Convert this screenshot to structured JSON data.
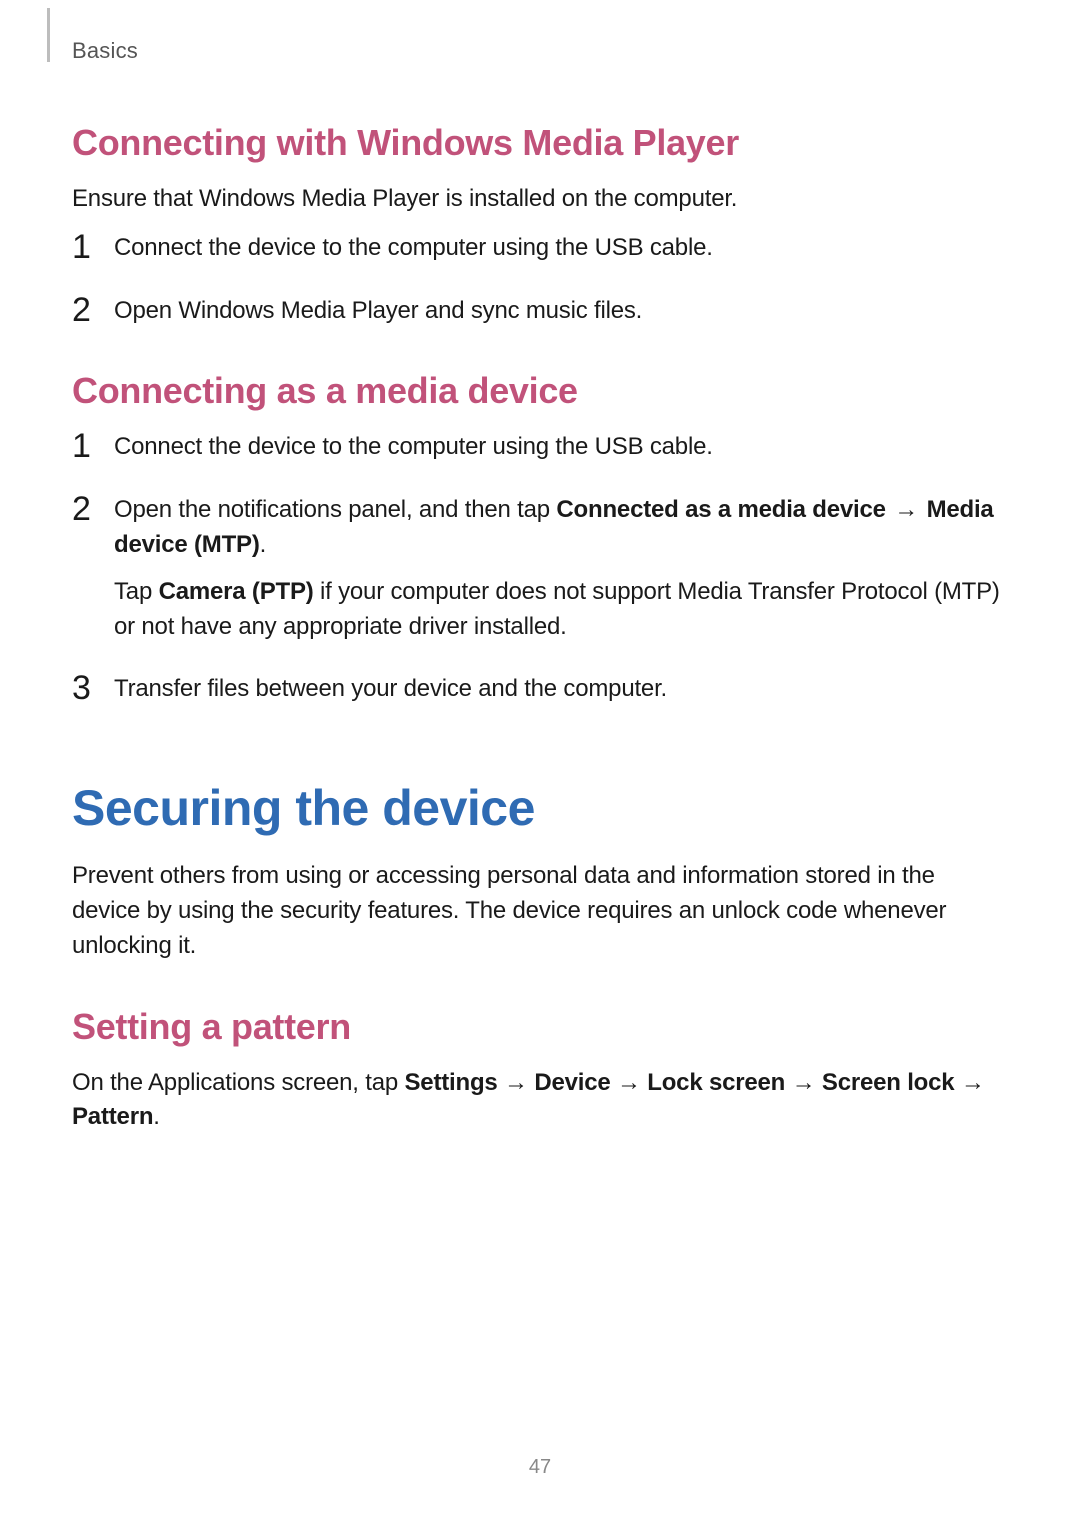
{
  "breadcrumb": "Basics",
  "page_number": "47",
  "arrow": "→",
  "section_wmp": {
    "heading": "Connecting with Windows Media Player",
    "intro": "Ensure that Windows Media Player is installed on the computer.",
    "steps": [
      "Connect the device to the computer using the USB cable.",
      "Open Windows Media Player and sync music files."
    ]
  },
  "section_media": {
    "heading": "Connecting as a media device",
    "step1": "Connect the device to the computer using the USB cable.",
    "step2": {
      "p1_a": "Open the notifications panel, and then tap ",
      "p1_b": "Connected as a media device",
      "p1_c": "Media device (MTP)",
      "p1_d": ".",
      "p2_a": "Tap ",
      "p2_b": "Camera (PTP)",
      "p2_c": " if your computer does not support Media Transfer Protocol (MTP) or not have any appropriate driver installed."
    },
    "step3": "Transfer files between your device and the computer."
  },
  "h1_securing": "Securing the device",
  "securing_intro": "Prevent others from using or accessing personal data and information stored in the device by using the security features. The device requires an unlock code whenever unlocking it.",
  "section_pattern": {
    "heading": "Setting a pattern",
    "p_a": "On the Applications screen, tap ",
    "path": [
      "Settings",
      "Device",
      "Lock screen",
      "Screen lock",
      "Pattern"
    ],
    "p_end": "."
  }
}
